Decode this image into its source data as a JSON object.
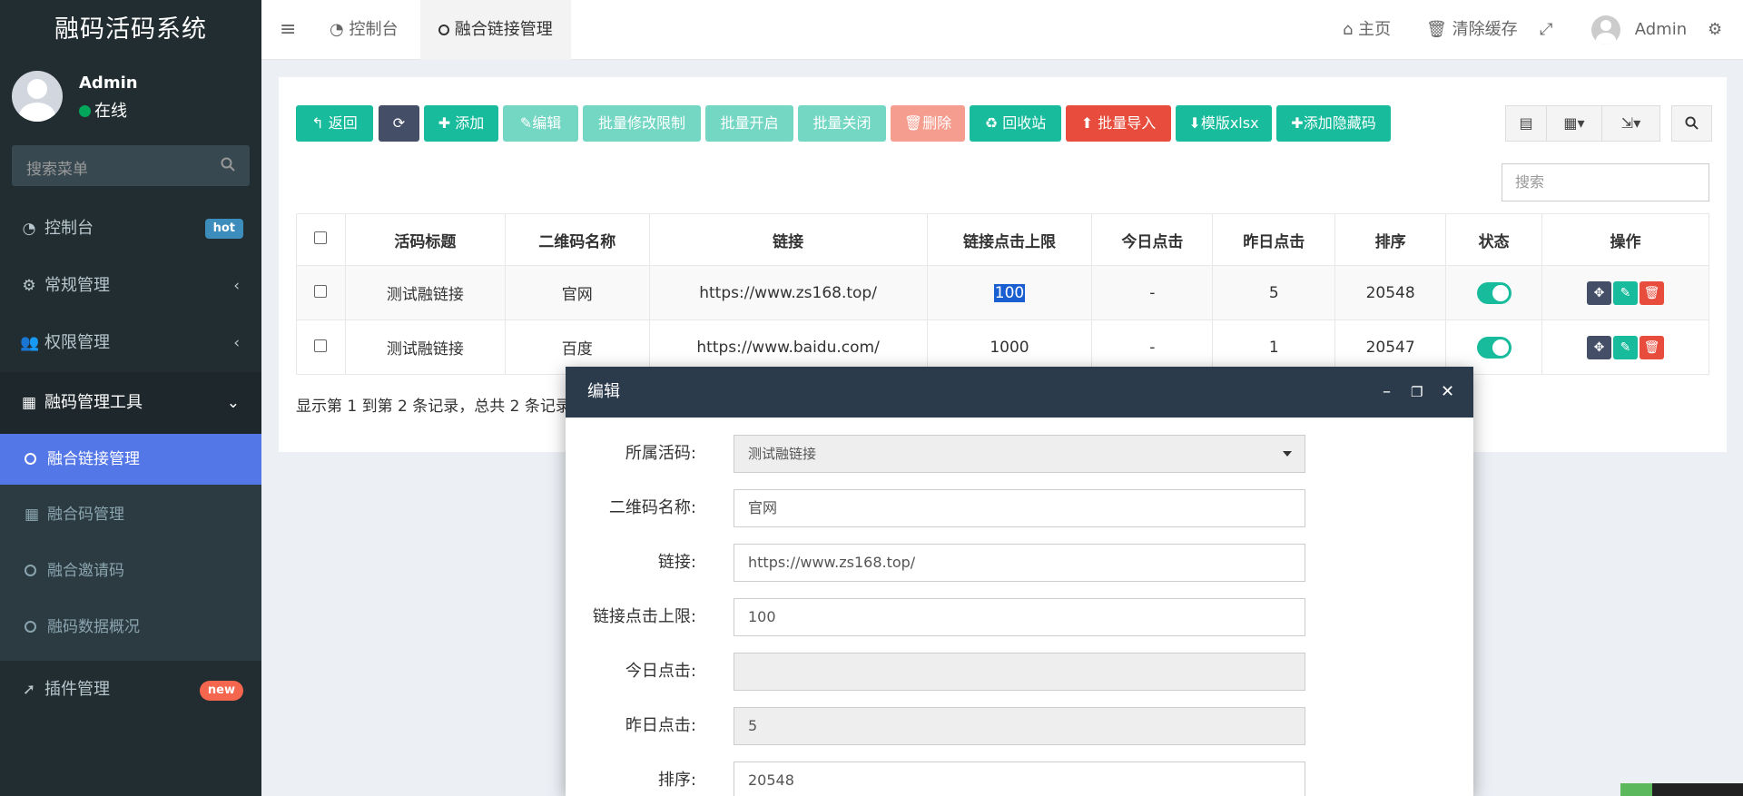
{
  "app": {
    "title": "融码活码系统"
  },
  "user": {
    "name": "Admin",
    "status": "在线"
  },
  "sidebar": {
    "search_placeholder": "搜索菜单",
    "items": [
      {
        "label": "控制台",
        "badge": "hot",
        "icon": "dashboard-icon"
      },
      {
        "label": "常规管理",
        "arrow": "‹",
        "icon": "cogs-icon"
      },
      {
        "label": "权限管理",
        "arrow": "‹",
        "icon": "users-icon"
      },
      {
        "label": "融码管理工具",
        "arrow": "⌄",
        "icon": "qrcode-icon"
      },
      {
        "label": "插件管理",
        "badge": "new",
        "icon": "rocket-icon"
      }
    ],
    "subitems": [
      {
        "label": "融合链接管理",
        "icon": "circle-icon",
        "active": true
      },
      {
        "label": "融合码管理",
        "icon": "qrcode-icon"
      },
      {
        "label": "融合邀请码",
        "icon": "circle-icon"
      },
      {
        "label": "融码数据概况",
        "icon": "circle-icon"
      }
    ]
  },
  "header": {
    "tabs": [
      {
        "label": "控制台",
        "icon": "dashboard-icon"
      },
      {
        "label": "融合链接管理",
        "icon": "circle-icon",
        "active": true
      }
    ],
    "home_label": "主页",
    "clear_cache_label": "清除缓存",
    "admin_label": "Admin"
  },
  "toolbar": {
    "back": "返回",
    "add": "添加",
    "edit": "编辑",
    "batch_limit": "批量修改限制",
    "batch_open": "批量开启",
    "batch_close": "批量关闭",
    "delete": "删除",
    "recycle": "回收站",
    "batch_import": "批量导入",
    "template": "模版xlsx",
    "add_hidden": "添加隐藏码"
  },
  "search": {
    "placeholder": "搜索"
  },
  "table": {
    "columns": [
      "活码标题",
      "二维码名称",
      "链接",
      "链接点击上限",
      "今日点击",
      "昨日点击",
      "排序",
      "状态",
      "操作"
    ],
    "rows": [
      {
        "title": "测试融链接",
        "qr_name": "官网",
        "link": "https://www.zs168.top/",
        "limit": "100",
        "today": "-",
        "yesterday": "5",
        "sort": "20548",
        "status": true
      },
      {
        "title": "测试融链接",
        "qr_name": "百度",
        "link": "https://www.baidu.com/",
        "limit": "1000",
        "today": "-",
        "yesterday": "1",
        "sort": "20547",
        "status": true
      }
    ],
    "summary": "显示第 1 到第 2 条记录，总共 2 条记录"
  },
  "modal": {
    "title": "编辑",
    "fields": [
      {
        "label": "所属活码:",
        "value": "测试融链接",
        "type": "select"
      },
      {
        "label": "二维码名称:",
        "value": "官网"
      },
      {
        "label": "链接:",
        "value": "https://www.zs168.top/"
      },
      {
        "label": "链接点击上限:",
        "value": "100"
      },
      {
        "label": "今日点击:",
        "value": "",
        "disabled": true
      },
      {
        "label": "昨日点击:",
        "value": "5",
        "disabled": true
      },
      {
        "label": "排序:",
        "value": "20548"
      }
    ]
  },
  "colors": {
    "sidebar_bg": "#222d32",
    "active_menu": "#5477e8",
    "success": "#18bc9c",
    "danger": "#e74c3c",
    "modal_header": "#2c3b4c"
  }
}
